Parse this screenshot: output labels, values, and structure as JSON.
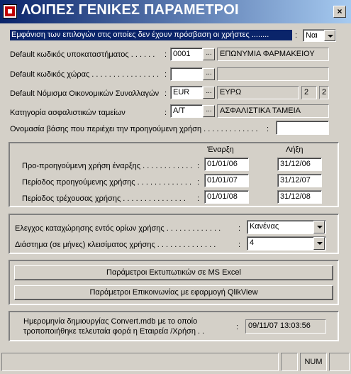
{
  "window": {
    "title": "ΛΟΙΠΕΣ ΓΕΝΙΚΕΣ ΠΑΡΑΜΕΤΡΟΙ",
    "close_glyph": "×"
  },
  "options_visibility": {
    "label": "Εμφάνιση των επιλογών στις οποίες δεν έχουν πρόσβαση οι χρήστες ........",
    "colon": ":",
    "value": "Ναι"
  },
  "branch_code": {
    "label": "Default κωδικός υποκαταστήματος . . . . . .",
    "colon": ":",
    "code": "0001",
    "button": "...",
    "name": "ΕΠΩΝΥΜΙΑ ΦΑΡΜΑΚΕΙΟΥ"
  },
  "country_code": {
    "label": "Default κωδικός χώρας . . . . . . . . . . . . . . . .",
    "colon": ":",
    "code": "",
    "button": "...",
    "name": ""
  },
  "currency": {
    "label": "Default Νόμισμα Οικονομικών Συναλλαγών",
    "colon": ":",
    "code": "EUR",
    "button": "...",
    "name": "ΕΥΡΩ",
    "val1": "2",
    "val2": "2"
  },
  "insurance_category": {
    "label": "Κατηγορία ασφαλιστικών ταμείων",
    "colon": ":",
    "code": "A/T",
    "button": "...",
    "name": "ΑΣΦΑΛΙΣΤΙΚΑ ΤΑΜΕΙΑ"
  },
  "previous_db": {
    "label": "Ονομασία βάσης που περιέχει την προηγούμενη χρήση . . . . . . . . . . . . .",
    "colon": ":",
    "value": ""
  },
  "periods": {
    "header_start": "Έναρξη",
    "header_end": "Λήξη",
    "rows": [
      {
        "label": "Προ-προηγούμενη χρήση έναρξης . . . . . . . . . . . .",
        "colon": ":",
        "start": "01/01/06",
        "end": "31/12/06"
      },
      {
        "label": "Περίοδος προηγούμενης χρήσης . . . . . . . . . . . . .",
        "colon": ":",
        "start": "01/01/07",
        "end": "31/12/07"
      },
      {
        "label": "Περίοδος τρέχουσας χρήσης . . . . . . . . . . . . . . .",
        "colon": ":",
        "start": "01/01/08",
        "end": "31/12/08"
      }
    ]
  },
  "checks": {
    "limits_label": "Ελεγχος καταχώρησης εντός ορίων χρήσης . . . . . . . . . . . . .",
    "limits_colon": ":",
    "limits_value": "Κανένας",
    "closing_label": "Διάστημα (σε μήνες) κλεισίματος χρήσης . . . . . . . . . . . . . .",
    "closing_colon": ":",
    "closing_value": "4"
  },
  "buttons": {
    "excel": "Παράμετροι Εκτυπωτικών σε MS Excel",
    "qlikview": "Παράμετροι Επικοινωνίας με εφαρμογή QlikView"
  },
  "convert": {
    "label_line1": "Ημερομηνία δημιουργίας Convert.mdb με το οποίο",
    "label_line2": "τροποποιήθηκε τελευταία φορά η Εταιρεία /Χρήση . .",
    "colon": ":",
    "value": "09/11/07 13:03:56"
  },
  "status_bar": {
    "num": "NUM"
  }
}
